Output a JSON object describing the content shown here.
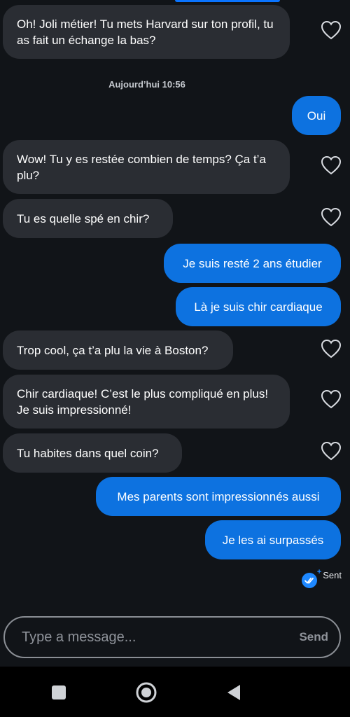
{
  "conversation": {
    "date_separator": "Aujourd’hui 10:56",
    "messages": [
      {
        "direction": "in",
        "text": "Oh! Joli métier! Tu mets Harvard sur ton profil, tu as fait un échange la bas?"
      },
      {
        "direction": "out",
        "text": "Oui"
      },
      {
        "direction": "in",
        "text": "Wow! Tu y es restée combien de temps? Ça t’a plu?"
      },
      {
        "direction": "in",
        "text": "Tu es quelle spé en chir?"
      },
      {
        "direction": "out",
        "text": "Je suis resté 2 ans étudier"
      },
      {
        "direction": "out",
        "text": "Là je suis chir cardiaque"
      },
      {
        "direction": "in",
        "text": "Trop cool, ça t’a plu la vie à Boston?"
      },
      {
        "direction": "in",
        "text": "Chir cardiaque! C’est le plus compliqué en plus! Je suis impressionné!"
      },
      {
        "direction": "in",
        "text": "Tu habites dans quel coin?"
      },
      {
        "direction": "out",
        "text": "Mes parents sont impressionnés aussi"
      },
      {
        "direction": "out",
        "text": "Je les ai surpassés"
      }
    ],
    "status": {
      "label": "Sent",
      "plus": "+"
    }
  },
  "composer": {
    "placeholder": "Type a message...",
    "value": "",
    "send_label": "Send"
  },
  "colors": {
    "background": "#111418",
    "incoming": "#2a2d33",
    "outgoing": "#0d72e0",
    "accent": "#1e88ff"
  },
  "icons": {
    "like": "heart-outline-icon",
    "read_receipt": "double-check-icon",
    "nav": [
      "square-recents-icon",
      "circle-home-icon",
      "triangle-back-icon"
    ]
  }
}
